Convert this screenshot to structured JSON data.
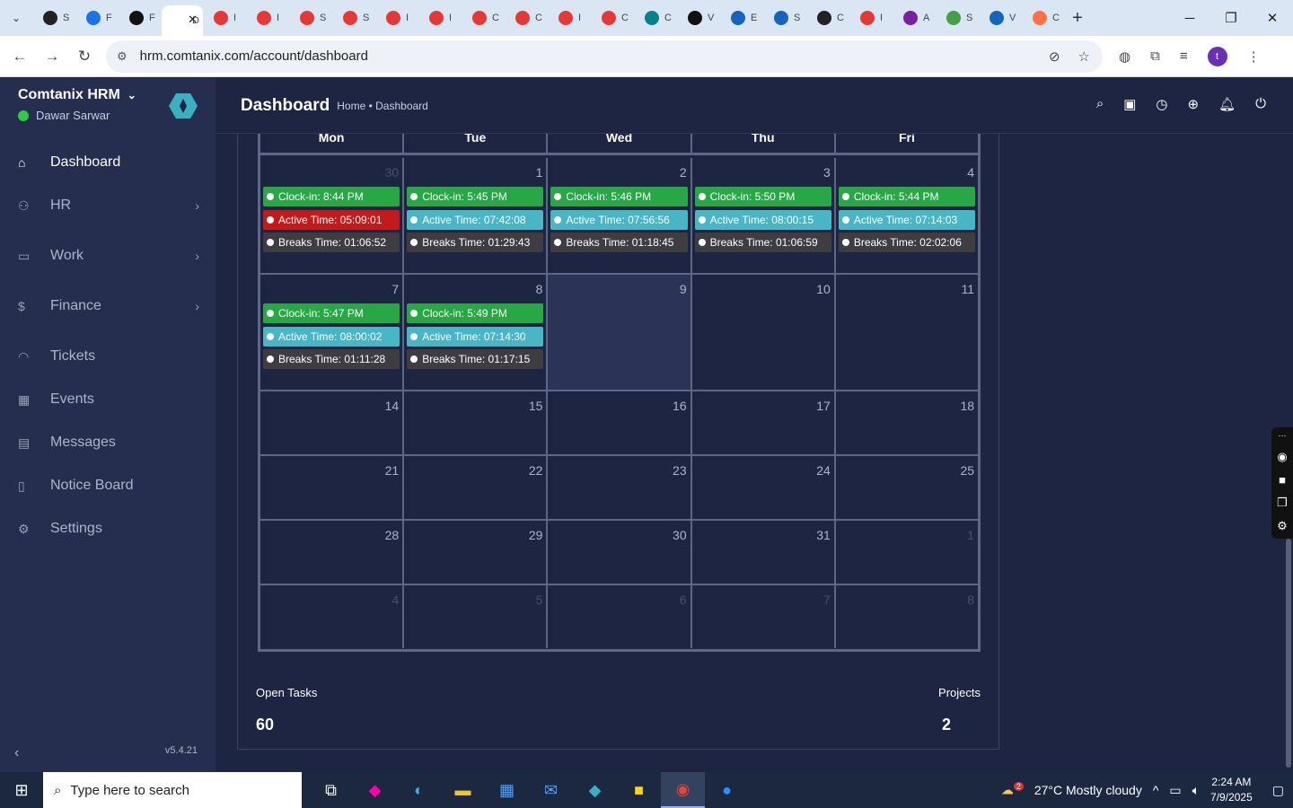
{
  "browser": {
    "url": "hrm.comtanix.com/account/dashboard",
    "tabs": [
      {
        "label": "S",
        "color": "#222"
      },
      {
        "label": "F",
        "color": "#1a73e8"
      },
      {
        "label": "F",
        "color": "#111"
      },
      {
        "label": "D",
        "color": "#fff",
        "active": true
      },
      {
        "label": "I",
        "color": "#e53935"
      },
      {
        "label": "I",
        "color": "#e53935"
      },
      {
        "label": "S",
        "color": "#e53935"
      },
      {
        "label": "S",
        "color": "#e53935"
      },
      {
        "label": "I",
        "color": "#e53935"
      },
      {
        "label": "I",
        "color": "#e53935"
      },
      {
        "label": "C",
        "color": "#e53935"
      },
      {
        "label": "C",
        "color": "#e53935"
      },
      {
        "label": "I",
        "color": "#e53935"
      },
      {
        "label": "C",
        "color": "#e53935"
      },
      {
        "label": "C",
        "color": "#00838f"
      },
      {
        "label": "V",
        "color": "#111"
      },
      {
        "label": "E",
        "color": "#1565c0"
      },
      {
        "label": "S",
        "color": "#1565c0"
      },
      {
        "label": "C",
        "color": "#222"
      },
      {
        "label": "I",
        "color": "#e53935"
      },
      {
        "label": "A",
        "color": "#7b1fa2"
      },
      {
        "label": "S",
        "color": "#43a047"
      },
      {
        "label": "V",
        "color": "#1565c0"
      },
      {
        "label": "C",
        "color": "#ff7043"
      }
    ],
    "profile_initial": "t"
  },
  "sidebar": {
    "brand": "Comtanix HRM",
    "user": "Dawar Sarwar",
    "version": "v5.4.21",
    "items": [
      {
        "label": "Dashboard",
        "icon": "home-icon",
        "active": true,
        "chevron": false
      },
      {
        "label": "HR",
        "icon": "users-icon",
        "chevron": true
      },
      {
        "label": "Work",
        "icon": "briefcase-icon",
        "chevron": true
      },
      {
        "label": "Finance",
        "icon": "dollar-icon",
        "chevron": true
      },
      {
        "label": "Tickets",
        "icon": "headset-icon",
        "chevron": false
      },
      {
        "label": "Events",
        "icon": "calendar-icon",
        "chevron": false
      },
      {
        "label": "Messages",
        "icon": "message-icon",
        "chevron": false
      },
      {
        "label": "Notice Board",
        "icon": "clipboard-icon",
        "chevron": false
      },
      {
        "label": "Settings",
        "icon": "gear-icon",
        "chevron": false
      }
    ]
  },
  "header": {
    "title": "Dashboard",
    "breadcrumb": "Home • Dashboard"
  },
  "calendar": {
    "days": [
      "Mon",
      "Tue",
      "Wed",
      "Thu",
      "Fri"
    ],
    "weeks": [
      [
        {
          "num": "30",
          "dim": true,
          "events": [
            {
              "text": "Clock-in: 8:44 PM",
              "color": "green"
            },
            {
              "text": "Active Time: 05:09:01",
              "color": "red"
            },
            {
              "text": "Breaks Time: 01:06:52",
              "color": "gray"
            }
          ]
        },
        {
          "num": "1",
          "events": [
            {
              "text": "Clock-in: 5:45 PM",
              "color": "green"
            },
            {
              "text": "Active Time: 07:42:08",
              "color": "teal"
            },
            {
              "text": "Breaks Time: 01:29:43",
              "color": "gray"
            }
          ]
        },
        {
          "num": "2",
          "events": [
            {
              "text": "Clock-in: 5:46 PM",
              "color": "green"
            },
            {
              "text": "Active Time: 07:56:56",
              "color": "teal"
            },
            {
              "text": "Breaks Time: 01:18:45",
              "color": "gray"
            }
          ]
        },
        {
          "num": "3",
          "events": [
            {
              "text": "Clock-in: 5:50 PM",
              "color": "green"
            },
            {
              "text": "Active Time: 08:00:15",
              "color": "teal"
            },
            {
              "text": "Breaks Time: 01:06:59",
              "color": "gray"
            }
          ]
        },
        {
          "num": "4",
          "events": [
            {
              "text": "Clock-in: 5:44 PM",
              "color": "green"
            },
            {
              "text": "Active Time: 07:14:03",
              "color": "teal"
            },
            {
              "text": "Breaks Time: 02:02:06",
              "color": "gray"
            }
          ]
        }
      ],
      [
        {
          "num": "7",
          "events": [
            {
              "text": "Clock-in: 5:47 PM",
              "color": "green"
            },
            {
              "text": "Active Time: 08:00:02",
              "color": "teal"
            },
            {
              "text": "Breaks Time: 01:11:28",
              "color": "gray"
            }
          ]
        },
        {
          "num": "8",
          "events": [
            {
              "text": "Clock-in: 5:49 PM",
              "color": "green"
            },
            {
              "text": "Active Time: 07:14:30",
              "color": "teal"
            },
            {
              "text": "Breaks Time: 01:17:15",
              "color": "gray"
            }
          ]
        },
        {
          "num": "9",
          "today": true,
          "events": []
        },
        {
          "num": "10",
          "events": []
        },
        {
          "num": "11",
          "events": []
        }
      ],
      [
        {
          "num": "14",
          "events": []
        },
        {
          "num": "15",
          "events": []
        },
        {
          "num": "16",
          "events": []
        },
        {
          "num": "17",
          "events": []
        },
        {
          "num": "18",
          "events": []
        }
      ],
      [
        {
          "num": "21",
          "events": []
        },
        {
          "num": "22",
          "events": []
        },
        {
          "num": "23",
          "events": []
        },
        {
          "num": "24",
          "events": []
        },
        {
          "num": "25",
          "events": []
        }
      ],
      [
        {
          "num": "28",
          "events": []
        },
        {
          "num": "29",
          "events": []
        },
        {
          "num": "30",
          "events": []
        },
        {
          "num": "31",
          "events": []
        },
        {
          "num": "1",
          "dim": true,
          "events": []
        }
      ],
      [
        {
          "num": "4",
          "dim": true,
          "events": []
        },
        {
          "num": "5",
          "dim": true,
          "events": []
        },
        {
          "num": "6",
          "dim": true,
          "events": []
        },
        {
          "num": "7",
          "dim": true,
          "events": []
        },
        {
          "num": "8",
          "dim": true,
          "events": []
        }
      ]
    ]
  },
  "stats": {
    "open_tasks_label": "Open Tasks",
    "open_tasks_value": "60",
    "projects_label": "Projects",
    "projects_value": "2"
  },
  "taskbar": {
    "search_placeholder": "Type here to search",
    "weather": "27°C  Mostly cloudy",
    "weather_badge": "2",
    "time": "2:24 AM",
    "date": "7/9/2025"
  },
  "colors": {
    "green": "#28a745",
    "teal": "#48b6c4",
    "red": "#c41a1a",
    "gray": "#3e3e42",
    "sidebar": "#262e4f",
    "page": "#1e2542"
  }
}
